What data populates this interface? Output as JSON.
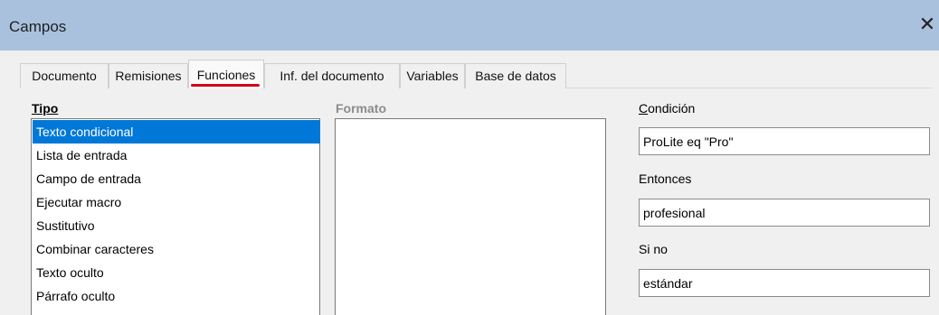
{
  "window": {
    "title": "Campos",
    "close_glyph": "✕"
  },
  "tabs": [
    {
      "label": "Documento"
    },
    {
      "label": "Remisiones"
    },
    {
      "label": "Funciones",
      "active": true
    },
    {
      "label": "Inf. del documento"
    },
    {
      "label": "Variables"
    },
    {
      "label": "Base de datos"
    }
  ],
  "colors": {
    "titlebar": "#a9c1dd",
    "selection": "#0078d7",
    "active_tab_underline": "#d0021b"
  },
  "type_panel": {
    "label": "Tipo",
    "items": [
      {
        "label": "Texto condicional",
        "selected": true
      },
      {
        "label": "Lista de entrada"
      },
      {
        "label": "Campo de entrada"
      },
      {
        "label": "Ejecutar macro"
      },
      {
        "label": "Sustitutivo"
      },
      {
        "label": "Combinar caracteres"
      },
      {
        "label": "Texto oculto"
      },
      {
        "label": "Párrafo oculto"
      }
    ]
  },
  "format_panel": {
    "label": "Formato"
  },
  "condition": {
    "label": "Condición",
    "value": "ProLite eq \"Pro\""
  },
  "then": {
    "label": "Entonces",
    "value": "profesional"
  },
  "else": {
    "label": "Si no",
    "value": "estándar"
  }
}
